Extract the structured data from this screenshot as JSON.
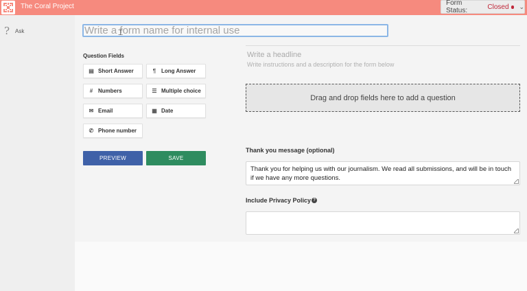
{
  "header": {
    "app_title": "The Coral Project",
    "status_label": "Form Status:",
    "status_value": "Closed",
    "chevron": "⌄"
  },
  "sidebar": {
    "items": [
      {
        "label": "Ask",
        "icon": "ear-icon"
      }
    ]
  },
  "form": {
    "name_placeholder": "Write a form name for internal use",
    "question_fields_title": "Question Fields",
    "fields": [
      {
        "label": "Short Answer",
        "icon": "document-icon"
      },
      {
        "label": "Long Answer",
        "icon": "paragraph-icon"
      },
      {
        "label": "Numbers",
        "icon": "hash-icon"
      },
      {
        "label": "Multiple choice",
        "icon": "list-icon"
      },
      {
        "label": "Email",
        "icon": "envelope-icon"
      },
      {
        "label": "Date",
        "icon": "calendar-icon"
      },
      {
        "label": "Phone number",
        "icon": "phone-icon"
      }
    ],
    "preview_label": "PREVIEW",
    "save_label": "SAVE",
    "headline_placeholder": "Write a headline",
    "description_placeholder": "Write instructions and a description for the form below",
    "dropzone_text": "Drag and drop fields here to add a question",
    "thank_you_label": "Thank you message (optional)",
    "thank_you_text": "Thank you for helping us with our journalism. We read all submissions, and will be in touch if we have any more questions.",
    "privacy_label": "Include Privacy Policy",
    "privacy_text": ""
  },
  "colors": {
    "topbar": "#f68a7e",
    "status_closed": "#c0283a",
    "preview_button": "#3f61a8",
    "save_button": "#2e8c5f"
  }
}
